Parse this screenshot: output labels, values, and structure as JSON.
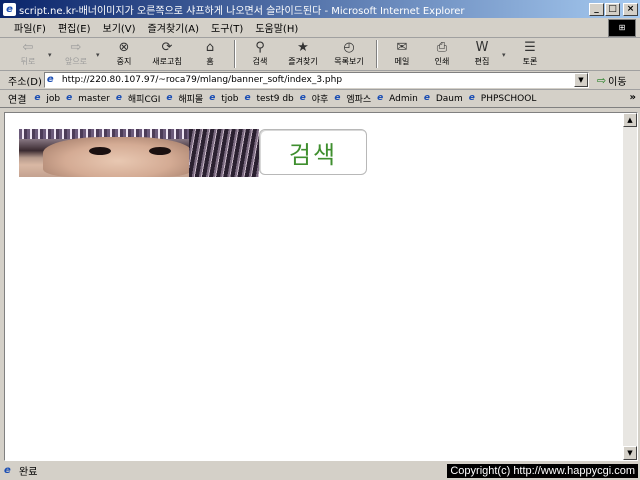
{
  "window": {
    "title": "script.ne.kr-배너이미지가 오른쪽으로 샤프하게 나오면서 슬라이드된다 - Microsoft Internet Explorer",
    "buttons": {
      "minimize": "_",
      "maximize": "□",
      "close": "×"
    }
  },
  "menubar": {
    "items": [
      "파일(F)",
      "편집(E)",
      "보기(V)",
      "즐겨찾기(A)",
      "도구(T)",
      "도움말(H)"
    ]
  },
  "toolbar": {
    "buttons": [
      {
        "label": "뒤로",
        "icon": "back-arrow-icon",
        "glyph": "⇦",
        "enabled": false
      },
      {
        "label": "앞으로",
        "icon": "forward-arrow-icon",
        "glyph": "⇨",
        "enabled": false
      },
      {
        "label": "중지",
        "icon": "stop-icon",
        "glyph": "⊗",
        "enabled": true
      },
      {
        "label": "새로고침",
        "icon": "refresh-icon",
        "glyph": "⟳",
        "enabled": true
      },
      {
        "label": "홈",
        "icon": "home-icon",
        "glyph": "⌂",
        "enabled": true
      },
      {
        "label": "검색",
        "icon": "search-icon",
        "glyph": "⚲",
        "enabled": true
      },
      {
        "label": "즐겨찾기",
        "icon": "favorites-icon",
        "glyph": "★",
        "enabled": true
      },
      {
        "label": "목록보기",
        "icon": "history-icon",
        "glyph": "◴",
        "enabled": true
      },
      {
        "label": "메일",
        "icon": "mail-icon",
        "glyph": "✉",
        "enabled": true
      },
      {
        "label": "인쇄",
        "icon": "print-icon",
        "glyph": "⎙",
        "enabled": true
      },
      {
        "label": "편집",
        "icon": "edit-icon",
        "glyph": "W",
        "enabled": true
      },
      {
        "label": "토론",
        "icon": "discuss-icon",
        "glyph": "☰",
        "enabled": true
      }
    ]
  },
  "address": {
    "label": "주소(D)",
    "url": "http://220.80.107.97/~roca79/mlang/banner_soft/index_3.php",
    "go_label": "이동"
  },
  "links": {
    "label": "연결",
    "items": [
      "job",
      "master",
      "해피CGI",
      "해피몰",
      "tjob",
      "test9 db",
      "야후",
      "엠파스",
      "Admin",
      "Daum",
      "PHPSCHOOL"
    ],
    "more": "»"
  },
  "page": {
    "search_button": "검색"
  },
  "status": {
    "text": "완료",
    "copyright": "Copyright(c) http://www.happycgi.com"
  },
  "colors": {
    "title_start": "#0a246a",
    "title_end": "#a6caf0",
    "search_text": "#3f8f2f",
    "chrome": "#d4d0c8"
  }
}
